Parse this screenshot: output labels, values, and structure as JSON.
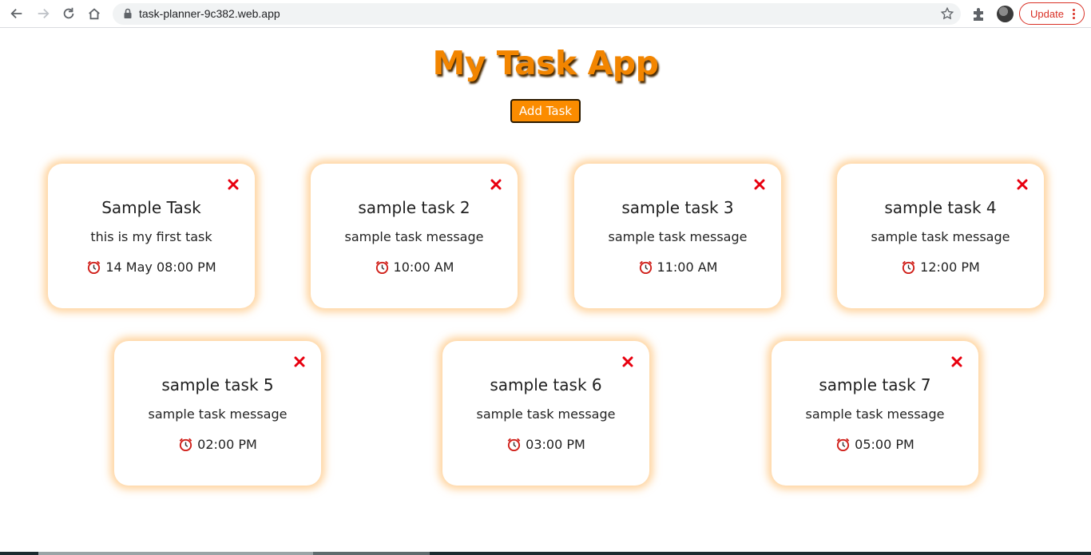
{
  "browser": {
    "url": "task-planner-9c382.web.app",
    "update_label": "Update"
  },
  "app": {
    "title": "My Task App",
    "add_task_label": "Add Task"
  },
  "tasks": [
    {
      "title": "Sample Task",
      "message": "this is my first task",
      "time": "14 May 08:00 PM"
    },
    {
      "title": "sample task 2",
      "message": "sample task message",
      "time": "10:00 AM"
    },
    {
      "title": "sample task 3",
      "message": "sample task message",
      "time": "11:00 AM"
    },
    {
      "title": "sample task 4",
      "message": "sample task message",
      "time": "12:00 PM"
    },
    {
      "title": "sample task 5",
      "message": "sample task message",
      "time": "02:00 PM"
    },
    {
      "title": "sample task 6",
      "message": "sample task message",
      "time": "03:00 PM"
    },
    {
      "title": "sample task 7",
      "message": "sample task message",
      "time": "05:00 PM"
    }
  ],
  "icons": {
    "delete": "close-x-icon",
    "time": "alarm-clock-icon"
  },
  "colors": {
    "accent": "#f28500",
    "button": "#fb8c00",
    "delete": "#e8000f",
    "card_glow": "#ffb050"
  }
}
